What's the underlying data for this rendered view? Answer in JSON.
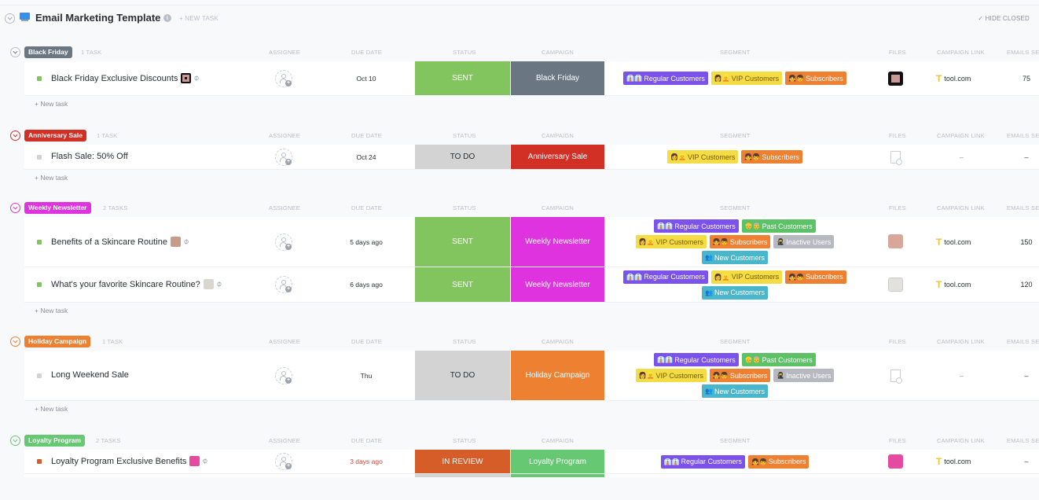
{
  "header": {
    "title": "Email Marketing Template",
    "new_task_label": "+ NEW TASK",
    "hide_closed_label": "HIDE CLOSED"
  },
  "columns": {
    "assignee": "ASSIGNEE",
    "due_date": "DUE DATE",
    "status": "STATUS",
    "campaign": "CAMPAIGN",
    "segment": "SEGMENT",
    "files": "FILES",
    "campaign_link": "CAMPAIGN LINK",
    "emails_sent": "EMAILS SE"
  },
  "new_task_row_label": "+ New task",
  "colors": {
    "sent": "#82c55f",
    "todo": "#d3d3d3",
    "in_review": "#d65c28",
    "black_friday": "#6b7683",
    "anniversary": "#d22f25",
    "weekly": "#e033e0",
    "holiday": "#ee8031",
    "loyalty": "#66c872",
    "regular": "#7b52ea",
    "vip": "#f3dc44",
    "subscribers": "#ee8031",
    "past": "#5dc167",
    "inactive": "#b6b9bf",
    "new": "#4ab6cc"
  },
  "groups": [
    {
      "name": "Black Friday",
      "count": "1 TASK",
      "tasks": [
        {
          "name": "Black Friday Exclusive Discounts",
          "has_attachment": true,
          "assignee": "",
          "due": "Oct 10",
          "status": "SENT",
          "campaign": "Black Friday",
          "segments": [
            "Regular Customers",
            "VIP Customers",
            "Subscribers"
          ],
          "file": "image",
          "link": "tool.com",
          "emails_sent": "75"
        }
      ]
    },
    {
      "name": "Anniversary Sale",
      "count": "1 TASK",
      "tasks": [
        {
          "name": "Flash Sale: 50% Off",
          "due": "Oct 24",
          "status": "TO DO",
          "campaign": "Anniversary Sale",
          "segments": [
            "VIP Customers",
            "Subscribers"
          ],
          "link": "–",
          "emails_sent": "–"
        }
      ]
    },
    {
      "name": "Weekly Newsletter",
      "count": "2 TASKS",
      "tasks": [
        {
          "name": "Benefits of a Skincare Routine",
          "due": "5 days ago",
          "status": "SENT",
          "campaign": "Weekly Newsletter",
          "segments": [
            "Regular Customers",
            "Past Customers",
            "VIP Customers",
            "Subscribers",
            "Inactive Users",
            "New Customers"
          ],
          "link": "tool.com",
          "emails_sent": "150"
        },
        {
          "name": "What's your favorite Skincare Routine?",
          "due": "6 days ago",
          "status": "SENT",
          "campaign": "Weekly Newsletter",
          "segments": [
            "Regular Customers",
            "VIP Customers",
            "Subscribers",
            "New Customers"
          ],
          "link": "tool.com",
          "emails_sent": "120"
        }
      ]
    },
    {
      "name": "Holiday Campaign",
      "count": "1 TASK",
      "tasks": [
        {
          "name": "Long Weekend Sale",
          "due": "Thu",
          "status": "TO DO",
          "campaign": "Holiday Campaign",
          "segments": [
            "Regular Customers",
            "Past Customers",
            "VIP Customers",
            "Subscribers",
            "Inactive Users",
            "New Customers"
          ],
          "link": "–",
          "emails_sent": "–"
        }
      ]
    },
    {
      "name": "Loyalty Program",
      "count": "2 TASKS",
      "tasks": [
        {
          "name": "Loyalty Program Exclusive Benefits",
          "due": "3 days ago",
          "status": "IN REVIEW",
          "campaign": "Loyalty Program",
          "segments": [
            "Regular Customers",
            "Subscribers"
          ],
          "link": "tool.com",
          "emails_sent": "–"
        }
      ]
    }
  ]
}
